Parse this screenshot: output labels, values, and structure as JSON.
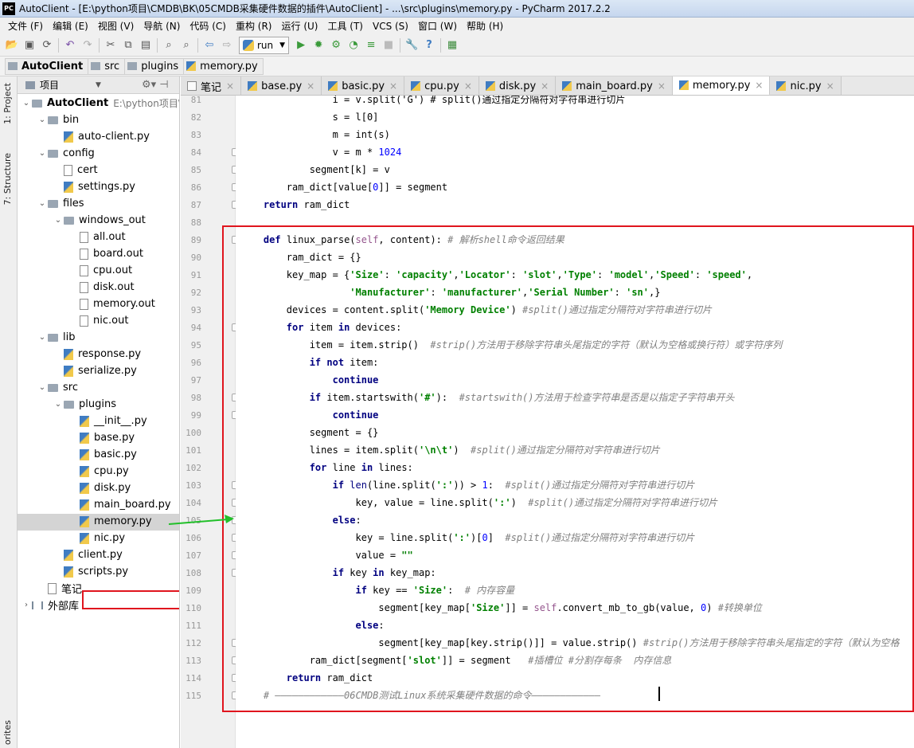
{
  "window": {
    "title": "AutoClient - [E:\\python项目\\CMDB\\BK\\05CMDB采集硬件数据的插件\\AutoClient] - ...\\src\\plugins\\memory.py - PyCharm 2017.2.2",
    "app_icon": "PC"
  },
  "menu": [
    "文件 (F)",
    "编辑 (E)",
    "视图 (V)",
    "导航 (N)",
    "代码 (C)",
    "重构 (R)",
    "运行 (U)",
    "工具 (T)",
    "VCS (S)",
    "窗口 (W)",
    "帮助 (H)"
  ],
  "toolbar": {
    "run_config": "run"
  },
  "breadcrumb": [
    "AutoClient",
    "src",
    "plugins",
    "memory.py"
  ],
  "side_tabs": {
    "project": "1: Project",
    "structure": "7: Structure",
    "favorites": "orites"
  },
  "project_panel": {
    "header": "项目",
    "tree": [
      {
        "label": "AutoClient",
        "sub": "E:\\python项目\\C",
        "kind": "folder",
        "open": true
      },
      {
        "label": "bin",
        "kind": "folder",
        "open": true
      },
      {
        "label": "auto-client.py",
        "kind": "py"
      },
      {
        "label": "config",
        "kind": "folder",
        "open": true
      },
      {
        "label": "cert",
        "kind": "txt"
      },
      {
        "label": "settings.py",
        "kind": "py"
      },
      {
        "label": "files",
        "kind": "folder",
        "open": true
      },
      {
        "label": "windows_out",
        "kind": "folder",
        "open": true
      },
      {
        "label": "all.out",
        "kind": "txt"
      },
      {
        "label": "board.out",
        "kind": "txt"
      },
      {
        "label": "cpu.out",
        "kind": "txt"
      },
      {
        "label": "disk.out",
        "kind": "txt"
      },
      {
        "label": "memory.out",
        "kind": "txt"
      },
      {
        "label": "nic.out",
        "kind": "txt"
      },
      {
        "label": "lib",
        "kind": "folder",
        "open": true
      },
      {
        "label": "response.py",
        "kind": "py"
      },
      {
        "label": "serialize.py",
        "kind": "py"
      },
      {
        "label": "src",
        "kind": "folder",
        "open": true
      },
      {
        "label": "plugins",
        "kind": "folder",
        "open": true
      },
      {
        "label": "__init__.py",
        "kind": "py"
      },
      {
        "label": "base.py",
        "kind": "py"
      },
      {
        "label": "basic.py",
        "kind": "py"
      },
      {
        "label": "cpu.py",
        "kind": "py"
      },
      {
        "label": "disk.py",
        "kind": "py"
      },
      {
        "label": "main_board.py",
        "kind": "py"
      },
      {
        "label": "memory.py",
        "kind": "py",
        "selected": true
      },
      {
        "label": "nic.py",
        "kind": "py"
      },
      {
        "label": "client.py",
        "kind": "py"
      },
      {
        "label": "scripts.py",
        "kind": "py"
      },
      {
        "label": "笔记",
        "kind": "txt"
      },
      {
        "label": "外部库",
        "kind": "lib"
      }
    ]
  },
  "editor_tabs": [
    {
      "label": "笔记",
      "active": false
    },
    {
      "label": "base.py",
      "active": false
    },
    {
      "label": "basic.py",
      "active": false
    },
    {
      "label": "cpu.py",
      "active": false
    },
    {
      "label": "disk.py",
      "active": false
    },
    {
      "label": "main_board.py",
      "active": false
    },
    {
      "label": "memory.py",
      "active": true
    },
    {
      "label": "nic.py",
      "active": false
    }
  ],
  "code": [
    {
      "n": "81",
      "t": [
        [
          "",
          "                i = v.split('G') # split()通过指定分隔符对字符串进行切片"
        ]
      ]
    },
    {
      "n": "82",
      "t": [
        [
          "",
          "                s = l[0]"
        ]
      ]
    },
    {
      "n": "83",
      "t": [
        [
          "",
          "                m = int(s)"
        ]
      ]
    },
    {
      "n": "84",
      "t": [
        [
          "",
          "                v = m * "
        ],
        [
          "nm",
          "1024"
        ]
      ]
    },
    {
      "n": "85",
      "t": [
        [
          "",
          "            segment[k] = v"
        ]
      ]
    },
    {
      "n": "86",
      "t": [
        [
          "",
          "        ram_dict[value["
        ],
        [
          "nm",
          "0"
        ],
        [
          "",
          "]] = segment"
        ]
      ]
    },
    {
      "n": "87",
      "t": [
        [
          "",
          "    "
        ],
        [
          "kw",
          "return"
        ],
        [
          "",
          " ram_dict"
        ]
      ]
    },
    {
      "n": "88",
      "t": [
        [
          "",
          ""
        ]
      ]
    },
    {
      "n": "89",
      "t": [
        [
          "",
          "    "
        ],
        [
          "kw",
          "def"
        ],
        [
          "",
          " linux_parse("
        ],
        [
          "sf",
          "self"
        ],
        [
          "",
          ", content):"
        ],
        [
          "cm",
          " # 解析shell命令返回结果"
        ]
      ]
    },
    {
      "n": "90",
      "t": [
        [
          "",
          "        ram_dict = {}"
        ]
      ]
    },
    {
      "n": "91",
      "t": [
        [
          "",
          "        key_map = {"
        ],
        [
          "st",
          "'Size'"
        ],
        [
          "",
          ": "
        ],
        [
          "st",
          "'capacity'"
        ],
        [
          "",
          ","
        ],
        [
          "st",
          "'Locator'"
        ],
        [
          "",
          ": "
        ],
        [
          "st",
          "'slot'"
        ],
        [
          "",
          ","
        ],
        [
          "st",
          "'Type'"
        ],
        [
          "",
          ": "
        ],
        [
          "st",
          "'model'"
        ],
        [
          "",
          ","
        ],
        [
          "st",
          "'Speed'"
        ],
        [
          "",
          ": "
        ],
        [
          "st",
          "'speed'"
        ],
        [
          "",
          ","
        ]
      ]
    },
    {
      "n": "92",
      "t": [
        [
          "",
          "                   "
        ],
        [
          "st",
          "'Manufacturer'"
        ],
        [
          "",
          ": "
        ],
        [
          "st",
          "'manufacturer'"
        ],
        [
          "",
          ","
        ],
        [
          "st",
          "'Serial Number'"
        ],
        [
          "",
          ": "
        ],
        [
          "st",
          "'sn'"
        ],
        [
          "",
          ",}"
        ]
      ]
    },
    {
      "n": "93",
      "t": [
        [
          "",
          "        devices = content.split("
        ],
        [
          "st",
          "'Memory Device'"
        ],
        [
          "",
          ")"
        ],
        [
          "cm",
          " #split()通过指定分隔符对字符串进行切片"
        ]
      ]
    },
    {
      "n": "94",
      "t": [
        [
          "",
          "        "
        ],
        [
          "kw",
          "for"
        ],
        [
          "",
          " item "
        ],
        [
          "kw",
          "in"
        ],
        [
          "",
          " devices:"
        ]
      ]
    },
    {
      "n": "95",
      "t": [
        [
          "",
          "            item = item.strip()"
        ],
        [
          "cm",
          "  #strip()方法用于移除字符串头尾指定的字符（默认为空格或换行符）或字符序列"
        ]
      ]
    },
    {
      "n": "96",
      "t": [
        [
          "",
          "            "
        ],
        [
          "kw",
          "if not"
        ],
        [
          "",
          " item:"
        ]
      ]
    },
    {
      "n": "97",
      "t": [
        [
          "",
          "                "
        ],
        [
          "kw",
          "continue"
        ]
      ]
    },
    {
      "n": "98",
      "t": [
        [
          "",
          "            "
        ],
        [
          "kw",
          "if"
        ],
        [
          "",
          " item.startswith("
        ],
        [
          "st",
          "'#'"
        ],
        [
          "",
          "):"
        ],
        [
          "cm",
          "  #startswith()方法用于检查字符串是否是以指定子字符串开头"
        ]
      ]
    },
    {
      "n": "99",
      "t": [
        [
          "",
          "                "
        ],
        [
          "kw",
          "continue"
        ]
      ]
    },
    {
      "n": "100",
      "t": [
        [
          "",
          "            segment = {}"
        ]
      ]
    },
    {
      "n": "101",
      "t": [
        [
          "",
          "            lines = item.split("
        ],
        [
          "st",
          "'\\n\\t'"
        ],
        [
          "",
          ")"
        ],
        [
          "cm",
          "  #split()通过指定分隔符对字符串进行切片"
        ]
      ]
    },
    {
      "n": "102",
      "t": [
        [
          "",
          "            "
        ],
        [
          "kw",
          "for"
        ],
        [
          "",
          " line "
        ],
        [
          "kw",
          "in"
        ],
        [
          "",
          " lines:"
        ]
      ]
    },
    {
      "n": "103",
      "t": [
        [
          "",
          "                "
        ],
        [
          "kw",
          "if"
        ],
        [
          "",
          " "
        ],
        [
          "bi",
          "len"
        ],
        [
          "",
          "(line.split("
        ],
        [
          "st",
          "':'"
        ],
        [
          "",
          ")) > "
        ],
        [
          "nm",
          "1"
        ],
        [
          "",
          ":"
        ],
        [
          "cm",
          "  #split()通过指定分隔符对字符串进行切片"
        ]
      ]
    },
    {
      "n": "104",
      "t": [
        [
          "",
          "                    key, value = line.split("
        ],
        [
          "st",
          "':'"
        ],
        [
          "",
          ")"
        ],
        [
          "cm",
          "  #split()通过指定分隔符对字符串进行切片"
        ]
      ]
    },
    {
      "n": "105",
      "t": [
        [
          "",
          "                "
        ],
        [
          "kw",
          "else"
        ],
        [
          "",
          ":"
        ]
      ]
    },
    {
      "n": "106",
      "t": [
        [
          "",
          "                    key = line.split("
        ],
        [
          "st",
          "':'"
        ],
        [
          "",
          ")["
        ],
        [
          "nm",
          "0"
        ],
        [
          "",
          "]"
        ],
        [
          "cm",
          "  #split()通过指定分隔符对字符串进行切片"
        ]
      ]
    },
    {
      "n": "107",
      "t": [
        [
          "",
          "                    value = "
        ],
        [
          "st",
          "\"\""
        ]
      ]
    },
    {
      "n": "108",
      "t": [
        [
          "",
          "                "
        ],
        [
          "kw",
          "if"
        ],
        [
          "",
          " key "
        ],
        [
          "kw",
          "in"
        ],
        [
          "",
          " key_map:"
        ]
      ]
    },
    {
      "n": "109",
      "t": [
        [
          "",
          "                    "
        ],
        [
          "kw",
          "if"
        ],
        [
          "",
          " key == "
        ],
        [
          "st",
          "'Size'"
        ],
        [
          "",
          ":"
        ],
        [
          "cm",
          "  # 内存容量"
        ]
      ]
    },
    {
      "n": "110",
      "t": [
        [
          "",
          "                        segment[key_map["
        ],
        [
          "st",
          "'Size'"
        ],
        [
          "",
          "]] = "
        ],
        [
          "sf",
          "self"
        ],
        [
          "",
          ".convert_mb_to_gb(value, "
        ],
        [
          "nm",
          "0"
        ],
        [
          "",
          ")"
        ],
        [
          "cm",
          " #转换单位"
        ]
      ]
    },
    {
      "n": "111",
      "t": [
        [
          "",
          "                    "
        ],
        [
          "kw",
          "else"
        ],
        [
          "",
          ":"
        ]
      ]
    },
    {
      "n": "112",
      "t": [
        [
          "",
          "                        segment[key_map[key.strip()]] = value.strip()"
        ],
        [
          "cm",
          " #strip()方法用于移除字符串头尾指定的字符（默认为空格"
        ]
      ]
    },
    {
      "n": "113",
      "t": [
        [
          "",
          "            ram_dict[segment["
        ],
        [
          "st",
          "'slot'"
        ],
        [
          "",
          "]] = segment"
        ],
        [
          "cm",
          "   #插槽位 #分割存每条  内存信息"
        ]
      ]
    },
    {
      "n": "114",
      "t": [
        [
          "",
          "        "
        ],
        [
          "kw",
          "return"
        ],
        [
          "",
          " ram_dict"
        ]
      ]
    },
    {
      "n": "115",
      "t": [
        [
          "cm",
          "    # ————————————06CMDB测试Linux系统采集硬件数据的命令————————————"
        ]
      ]
    }
  ]
}
